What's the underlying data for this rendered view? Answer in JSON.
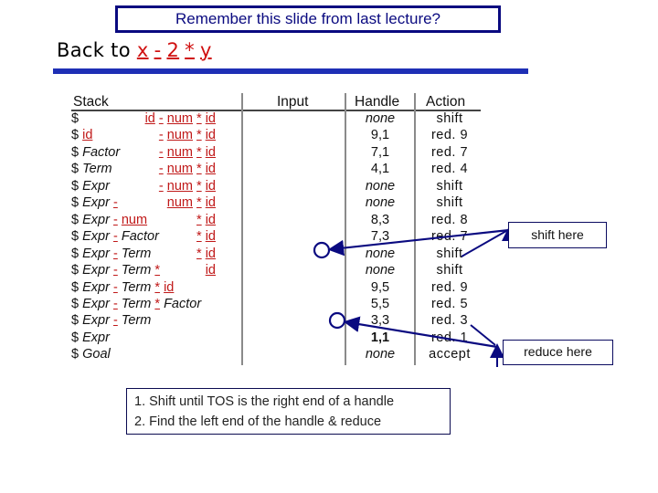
{
  "title": "Remember this slide from last lecture?",
  "subtitle": {
    "prefix": "Back to",
    "expression_tokens": [
      "x",
      "-",
      "2",
      "*",
      "y"
    ]
  },
  "table": {
    "headers": [
      "Stack",
      "Input",
      "Handle",
      "Action"
    ],
    "rows": [
      {
        "stack": [
          {
            "t": "$",
            "k": "plain"
          }
        ],
        "input": [
          {
            "t": "id",
            "k": "t"
          },
          {
            "t": "-",
            "k": "t"
          },
          {
            "t": "num",
            "k": "t"
          },
          {
            "t": "*",
            "k": "t"
          },
          {
            "t": "id",
            "k": "t"
          }
        ],
        "handle": "none",
        "action": "shift"
      },
      {
        "stack": [
          {
            "t": "$",
            "k": "plain"
          },
          {
            "t": "id",
            "k": "t"
          }
        ],
        "input": [
          {
            "t": "-",
            "k": "t"
          },
          {
            "t": "num",
            "k": "t"
          },
          {
            "t": "*",
            "k": "t"
          },
          {
            "t": "id",
            "k": "t"
          }
        ],
        "handle": "9,1",
        "action": "red. 9"
      },
      {
        "stack": [
          {
            "t": "$",
            "k": "plain"
          },
          {
            "t": "Factor",
            "k": "nt"
          }
        ],
        "input": [
          {
            "t": "-",
            "k": "t"
          },
          {
            "t": "num",
            "k": "t"
          },
          {
            "t": "*",
            "k": "t"
          },
          {
            "t": "id",
            "k": "t"
          }
        ],
        "handle": "7,1",
        "action": "red. 7"
      },
      {
        "stack": [
          {
            "t": "$",
            "k": "plain"
          },
          {
            "t": "Term",
            "k": "nt"
          }
        ],
        "input": [
          {
            "t": "-",
            "k": "t"
          },
          {
            "t": "num",
            "k": "t"
          },
          {
            "t": "*",
            "k": "t"
          },
          {
            "t": "id",
            "k": "t"
          }
        ],
        "handle": "4,1",
        "action": "red. 4"
      },
      {
        "stack": [
          {
            "t": "$",
            "k": "plain"
          },
          {
            "t": "Expr",
            "k": "nt"
          }
        ],
        "input": [
          {
            "t": "-",
            "k": "t"
          },
          {
            "t": "num",
            "k": "t"
          },
          {
            "t": "*",
            "k": "t"
          },
          {
            "t": "id",
            "k": "t"
          }
        ],
        "handle": "none",
        "action": "shift"
      },
      {
        "stack": [
          {
            "t": "$",
            "k": "plain"
          },
          {
            "t": "Expr",
            "k": "nt"
          },
          {
            "t": "-",
            "k": "t"
          }
        ],
        "input": [
          {
            "t": "num",
            "k": "t"
          },
          {
            "t": "*",
            "k": "t"
          },
          {
            "t": "id",
            "k": "t"
          }
        ],
        "handle": "none",
        "action": "shift"
      },
      {
        "stack": [
          {
            "t": "$",
            "k": "plain"
          },
          {
            "t": "Expr",
            "k": "nt"
          },
          {
            "t": "-",
            "k": "t"
          },
          {
            "t": "num",
            "k": "t"
          }
        ],
        "input": [
          {
            "t": "*",
            "k": "t"
          },
          {
            "t": "id",
            "k": "t"
          }
        ],
        "handle": "8,3",
        "action": "red. 8"
      },
      {
        "stack": [
          {
            "t": "$",
            "k": "plain"
          },
          {
            "t": "Expr",
            "k": "nt"
          },
          {
            "t": "-",
            "k": "t"
          },
          {
            "t": "Factor",
            "k": "nt"
          }
        ],
        "input": [
          {
            "t": "*",
            "k": "t"
          },
          {
            "t": "id",
            "k": "t"
          }
        ],
        "handle": "7,3",
        "action": "red. 7"
      },
      {
        "stack": [
          {
            "t": "$",
            "k": "plain"
          },
          {
            "t": "Expr",
            "k": "nt"
          },
          {
            "t": "-",
            "k": "t"
          },
          {
            "t": "Term",
            "k": "nt"
          }
        ],
        "input": [
          {
            "t": "*",
            "k": "t"
          },
          {
            "t": "id",
            "k": "t"
          }
        ],
        "handle": "none",
        "action": "shift"
      },
      {
        "stack": [
          {
            "t": "$",
            "k": "plain"
          },
          {
            "t": "Expr",
            "k": "nt"
          },
          {
            "t": "-",
            "k": "t"
          },
          {
            "t": "Term",
            "k": "nt"
          },
          {
            "t": "*",
            "k": "t"
          }
        ],
        "input": [
          {
            "t": "id",
            "k": "t"
          }
        ],
        "handle": "none",
        "action": "shift"
      },
      {
        "stack": [
          {
            "t": "$",
            "k": "plain"
          },
          {
            "t": "Expr",
            "k": "nt"
          },
          {
            "t": "-",
            "k": "t"
          },
          {
            "t": "Term",
            "k": "nt"
          },
          {
            "t": "*",
            "k": "t"
          },
          {
            "t": "id",
            "k": "t"
          }
        ],
        "input": [],
        "handle": "9,5",
        "action": "red. 9"
      },
      {
        "stack": [
          {
            "t": "$",
            "k": "plain"
          },
          {
            "t": "Expr",
            "k": "nt"
          },
          {
            "t": "-",
            "k": "t"
          },
          {
            "t": "Term",
            "k": "nt"
          },
          {
            "t": "*",
            "k": "t"
          },
          {
            "t": "Factor",
            "k": "nt"
          }
        ],
        "input": [],
        "handle": "5,5",
        "action": "red. 5"
      },
      {
        "stack": [
          {
            "t": "$",
            "k": "plain"
          },
          {
            "t": "Expr",
            "k": "nt"
          },
          {
            "t": "-",
            "k": "t"
          },
          {
            "t": "Term",
            "k": "nt"
          }
        ],
        "input": [],
        "handle": "3,3",
        "action": "red. 3"
      },
      {
        "stack": [
          {
            "t": "$",
            "k": "plain"
          },
          {
            "t": "Expr",
            "k": "nt"
          }
        ],
        "input": [],
        "handle": "1,1",
        "action": "red. 1"
      },
      {
        "stack": [
          {
            "t": "$",
            "k": "plain"
          },
          {
            "t": "Goal",
            "k": "nt"
          }
        ],
        "input": [],
        "handle": "none",
        "action": "accept"
      }
    ]
  },
  "annotations": {
    "shift_note": "shift here",
    "reduce_note": "reduce here"
  },
  "steps": [
    "1. Shift until TOS is the right end of a handle",
    "2. Find the left end of the handle & reduce"
  ],
  "colors": {
    "title_border": "#0a0a80",
    "rule": "#1e2fb5",
    "terminal": "#c01818",
    "arrow": "#0a0a80"
  }
}
